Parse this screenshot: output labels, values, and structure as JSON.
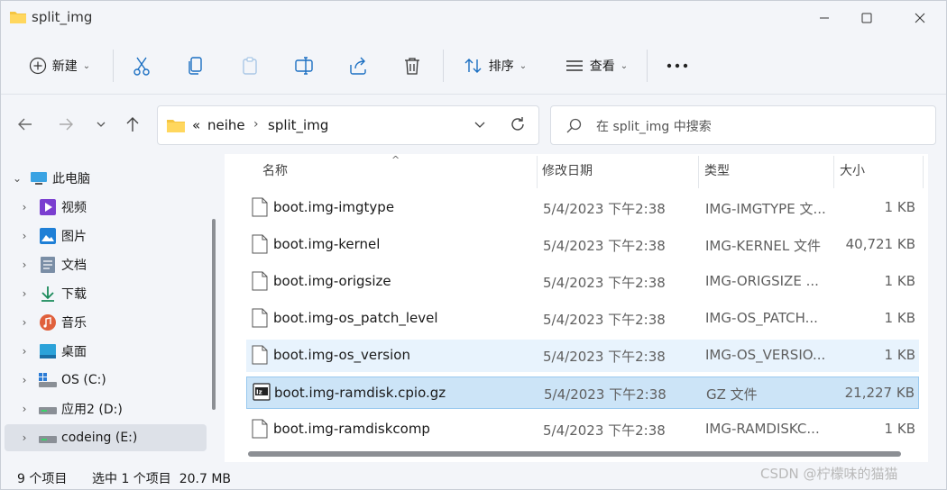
{
  "window": {
    "title": "split_img"
  },
  "toolbar": {
    "new_label": "新建",
    "sort_label": "排序",
    "view_label": "查看"
  },
  "address": {
    "overflow": "«",
    "segments": [
      "neihe",
      "split_img"
    ]
  },
  "search": {
    "placeholder": "在 split_img 中搜索"
  },
  "sidebar": {
    "items": [
      {
        "label": "此电脑",
        "icon": "computer-icon"
      },
      {
        "label": "视频",
        "icon": "video-icon"
      },
      {
        "label": "图片",
        "icon": "pictures-icon"
      },
      {
        "label": "文档",
        "icon": "documents-icon"
      },
      {
        "label": "下载",
        "icon": "download-icon"
      },
      {
        "label": "音乐",
        "icon": "music-icon"
      },
      {
        "label": "桌面",
        "icon": "desktop-icon"
      },
      {
        "label": "OS (C:)",
        "icon": "drive-icon"
      },
      {
        "label": "应用2 (D:)",
        "icon": "drive-icon"
      },
      {
        "label": "codeing (E:)",
        "icon": "drive-icon"
      }
    ]
  },
  "columns": {
    "name": "名称",
    "modified": "修改日期",
    "type": "类型",
    "size": "大小"
  },
  "files": [
    {
      "name": "boot.img-imgtype",
      "modified": "5/4/2023 下午2:38",
      "type": "IMG-IMGTYPE 文...",
      "size": "1 KB"
    },
    {
      "name": "boot.img-kernel",
      "modified": "5/4/2023 下午2:38",
      "type": "IMG-KERNEL 文件",
      "size": "40,721 KB"
    },
    {
      "name": "boot.img-origsize",
      "modified": "5/4/2023 下午2:38",
      "type": "IMG-ORIGSIZE ...",
      "size": "1 KB"
    },
    {
      "name": "boot.img-os_patch_level",
      "modified": "5/4/2023 下午2:38",
      "type": "IMG-OS_PATCH...",
      "size": "1 KB"
    },
    {
      "name": "boot.img-os_version",
      "modified": "5/4/2023 下午2:38",
      "type": "IMG-OS_VERSIO...",
      "size": "1 KB"
    },
    {
      "name": "boot.img-ramdisk.cpio.gz",
      "modified": "5/4/2023 下午2:38",
      "type": "GZ 文件",
      "size": "21,227 KB"
    },
    {
      "name": "boot.img-ramdiskcomp",
      "modified": "5/4/2023 下午2:38",
      "type": "IMG-RAMDISKC...",
      "size": "1 KB"
    }
  ],
  "status": {
    "item_count": "9 个项目",
    "selection": "选中 1 个项目  20.7 MB"
  },
  "watermark": "CSDN @柠檬味的猫猫"
}
